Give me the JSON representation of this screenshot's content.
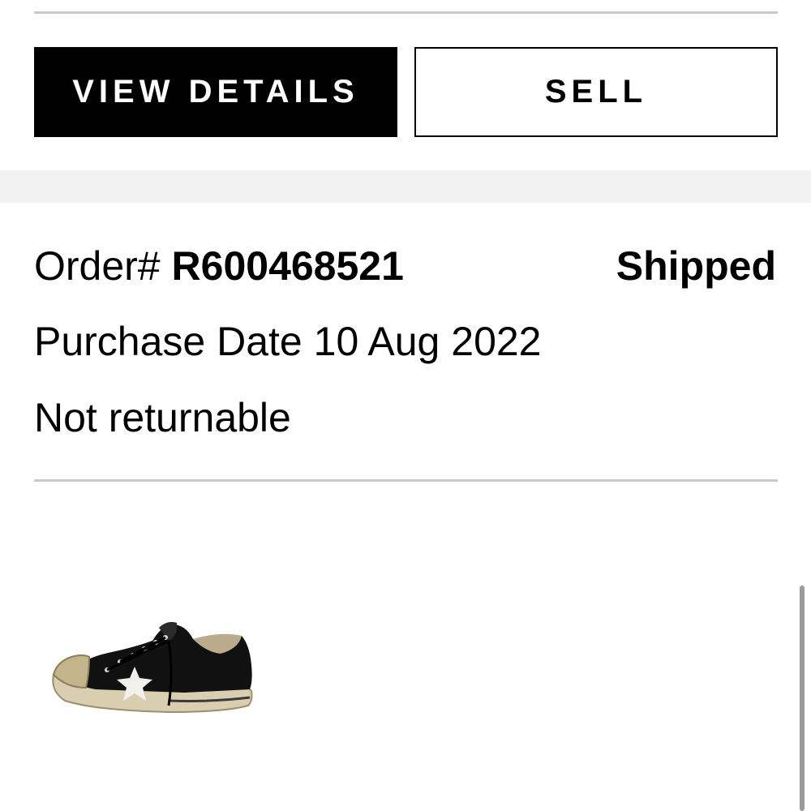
{
  "actions": {
    "view_details_label": "VIEW DETAILS",
    "sell_label": "SELL"
  },
  "order": {
    "order_label": "Order#",
    "order_number": "R600468521",
    "status": "Shipped",
    "purchase_date_label": "Purchase Date",
    "purchase_date": "10 Aug 2022",
    "return_policy": "Not returnable"
  },
  "product": {
    "image_icon": "sneaker-image"
  },
  "colors": {
    "primary": "#000000",
    "background": "#ffffff",
    "band": "#f2f2f2",
    "divider": "#c9c9c9"
  }
}
